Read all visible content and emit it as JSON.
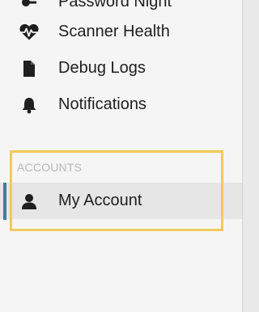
{
  "sidebar": {
    "items": [
      {
        "label": "Password Night",
        "icon": "key-icon"
      },
      {
        "label": "Scanner Health",
        "icon": "heartbeat-icon"
      },
      {
        "label": "Debug Logs",
        "icon": "document-icon"
      },
      {
        "label": "Notifications",
        "icon": "bell-icon"
      }
    ],
    "accounts_section": {
      "title": "ACCOUNTS",
      "items": [
        {
          "label": "My Account",
          "icon": "user-icon",
          "active": true
        }
      ]
    }
  },
  "colors": {
    "active_indicator": "#3b7f96",
    "highlight": "#f2c95b",
    "section_label": "#b8b8b8"
  }
}
